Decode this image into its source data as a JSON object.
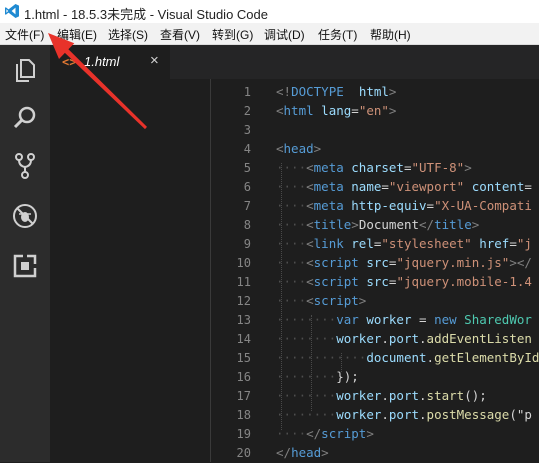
{
  "titlebar": {
    "title": "1.html - 18.5.3未完成 - Visual Studio Code"
  },
  "menu": {
    "items": [
      "文件(F)",
      "编辑(E)",
      "选择(S)",
      "查看(V)",
      "转到(G)",
      "调试(D)",
      "任务(T)",
      "帮助(H)"
    ]
  },
  "activitybar": {
    "icons": [
      "explorer-icon",
      "search-icon",
      "source-control-icon",
      "debug-icon",
      "extensions-icon"
    ]
  },
  "tab": {
    "icon": "<>",
    "label": "1.html",
    "close": "×"
  },
  "editor": {
    "line_numbers": [
      "1",
      "2",
      "3",
      "4",
      "5",
      "6",
      "7",
      "8",
      "9",
      "10",
      "11",
      "12",
      "13",
      "14",
      "15",
      "16",
      "17",
      "18",
      "19",
      "20"
    ],
    "lines": [
      [
        [
          "pn",
          "<!"
        ],
        [
          "tg",
          "DOCTYPE"
        ],
        [
          "",
          "  "
        ],
        [
          "at",
          "html"
        ],
        [
          "pn",
          ">"
        ]
      ],
      [
        [
          "pn",
          "<"
        ],
        [
          "tg",
          "html"
        ],
        [
          "",
          " "
        ],
        [
          "at",
          "lang"
        ],
        [
          "",
          "="
        ],
        [
          "st",
          "\"en\""
        ],
        [
          "pn",
          ">"
        ]
      ],
      [],
      [
        [
          "pn",
          "<"
        ],
        [
          "tg",
          "head"
        ],
        [
          "pn",
          ">"
        ]
      ],
      [
        [
          "ind",
          "····"
        ],
        [
          "pn",
          "<"
        ],
        [
          "tg",
          "meta"
        ],
        [
          "",
          " "
        ],
        [
          "at",
          "charset"
        ],
        [
          "",
          "="
        ],
        [
          "st",
          "\"UTF-8\""
        ],
        [
          "pn",
          ">"
        ]
      ],
      [
        [
          "ind",
          "····"
        ],
        [
          "pn",
          "<"
        ],
        [
          "tg",
          "meta"
        ],
        [
          "",
          " "
        ],
        [
          "at",
          "name"
        ],
        [
          "",
          "="
        ],
        [
          "st",
          "\"viewport\""
        ],
        [
          "",
          " "
        ],
        [
          "at",
          "content"
        ],
        [
          "",
          "="
        ]
      ],
      [
        [
          "ind",
          "····"
        ],
        [
          "pn",
          "<"
        ],
        [
          "tg",
          "meta"
        ],
        [
          "",
          " "
        ],
        [
          "at",
          "http-equiv"
        ],
        [
          "",
          "="
        ],
        [
          "st",
          "\"X-UA-Compati"
        ]
      ],
      [
        [
          "ind",
          "····"
        ],
        [
          "pn",
          "<"
        ],
        [
          "tg",
          "title"
        ],
        [
          "pn",
          ">"
        ],
        [
          "",
          "Document"
        ],
        [
          "pn",
          "</"
        ],
        [
          "tg",
          "title"
        ],
        [
          "pn",
          ">"
        ]
      ],
      [
        [
          "ind",
          "····"
        ],
        [
          "pn",
          "<"
        ],
        [
          "tg",
          "link"
        ],
        [
          "",
          " "
        ],
        [
          "at",
          "rel"
        ],
        [
          "",
          "="
        ],
        [
          "st",
          "\"stylesheet\""
        ],
        [
          "",
          " "
        ],
        [
          "at",
          "href"
        ],
        [
          "",
          "="
        ],
        [
          "st",
          "\"j"
        ]
      ],
      [
        [
          "ind",
          "····"
        ],
        [
          "pn",
          "<"
        ],
        [
          "tg",
          "script"
        ],
        [
          "",
          " "
        ],
        [
          "at",
          "src"
        ],
        [
          "",
          "="
        ],
        [
          "st",
          "\"jquery.min.js\""
        ],
        [
          "pn",
          "></"
        ]
      ],
      [
        [
          "ind",
          "····"
        ],
        [
          "pn",
          "<"
        ],
        [
          "tg",
          "script"
        ],
        [
          "",
          " "
        ],
        [
          "at",
          "src"
        ],
        [
          "",
          "="
        ],
        [
          "st",
          "\"jquery.mobile-1.4"
        ]
      ],
      [
        [
          "ind",
          "····"
        ],
        [
          "pn",
          "<"
        ],
        [
          "tg",
          "script"
        ],
        [
          "pn",
          ">"
        ]
      ],
      [
        [
          "ind",
          "········"
        ],
        [
          "kw",
          "var"
        ],
        [
          "",
          " "
        ],
        [
          "vr",
          "worker"
        ],
        [
          "",
          " = "
        ],
        [
          "kw",
          "new"
        ],
        [
          "",
          " "
        ],
        [
          "cl",
          "SharedWor"
        ]
      ],
      [
        [
          "ind",
          "········"
        ],
        [
          "vr",
          "worker"
        ],
        [
          "",
          "."
        ],
        [
          "vr",
          "port"
        ],
        [
          "",
          "."
        ],
        [
          "fn",
          "addEventListen"
        ]
      ],
      [
        [
          "ind",
          "············"
        ],
        [
          "vr",
          "document"
        ],
        [
          "",
          "."
        ],
        [
          "fn",
          "getElementById"
        ]
      ],
      [
        [
          "ind",
          "········"
        ],
        [
          "",
          "});"
        ]
      ],
      [
        [
          "ind",
          "········"
        ],
        [
          "vr",
          "worker"
        ],
        [
          "",
          "."
        ],
        [
          "vr",
          "port"
        ],
        [
          "",
          "."
        ],
        [
          "fn",
          "start"
        ],
        [
          "",
          "();"
        ]
      ],
      [
        [
          "ind",
          "········"
        ],
        [
          "vr",
          "worker"
        ],
        [
          "",
          "."
        ],
        [
          "vr",
          "port"
        ],
        [
          "",
          "."
        ],
        [
          "fn",
          "postMessage"
        ],
        [
          "",
          "(\"p"
        ]
      ],
      [
        [
          "ind",
          "····"
        ],
        [
          "pn",
          "</"
        ],
        [
          "tg",
          "script"
        ],
        [
          "pn",
          ">"
        ]
      ],
      [
        [
          "pn",
          "</"
        ],
        [
          "tg",
          "head"
        ],
        [
          "pn",
          ">"
        ]
      ]
    ]
  },
  "colors": {
    "annotation_arrow": "#e8322a",
    "editor_bg": "#1e1e1e",
    "activitybar_bg": "#2c2c2c",
    "tab_icon": "#e37933"
  }
}
